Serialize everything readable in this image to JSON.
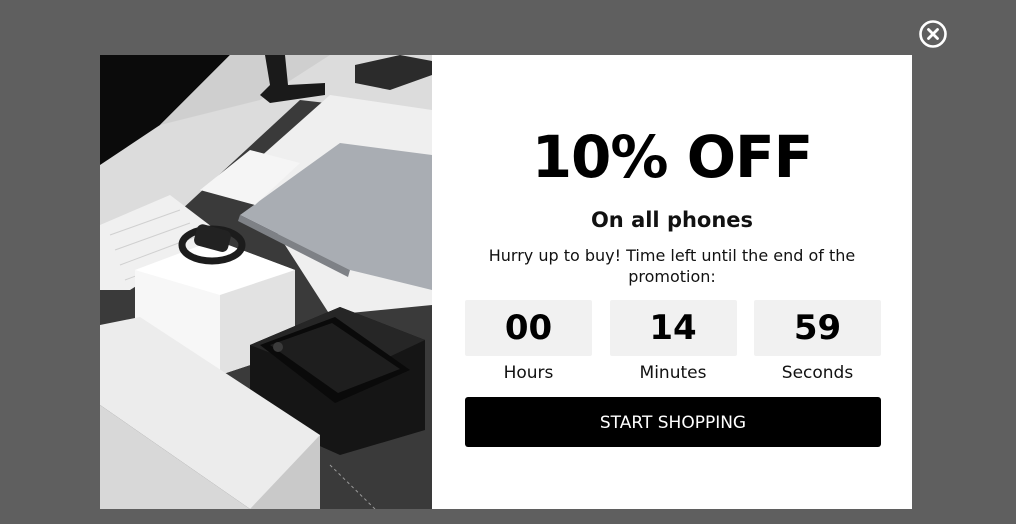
{
  "popup": {
    "headline": "10% OFF",
    "subheadline": "On all phones",
    "description": "Hurry up to buy! Time left until the end of the promotion:",
    "countdown": [
      {
        "value": "00",
        "label": "Hours"
      },
      {
        "value": "14",
        "label": "Minutes"
      },
      {
        "value": "59",
        "label": "Seconds"
      }
    ],
    "cta_label": "START SHOPPING"
  },
  "icons": {
    "close": "close-circle-icon"
  },
  "colors": {
    "overlay": "#5f5f5f",
    "modal": "#ffffff",
    "timer_box": "#f1f1f1",
    "cta": "#000000",
    "cta_text": "#ffffff"
  }
}
